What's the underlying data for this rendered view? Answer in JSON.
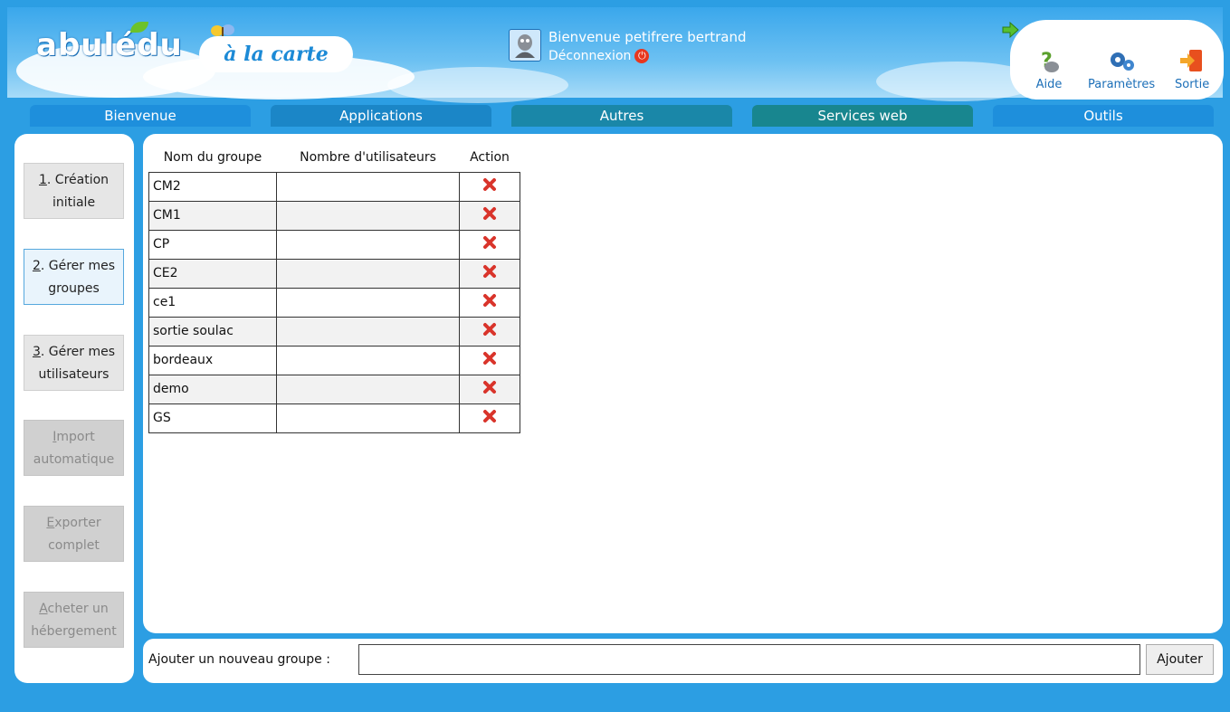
{
  "header": {
    "logo_text": "abulédu",
    "badge_text": "à la carte",
    "welcome_text": "Bienvenue petifrere bertrand",
    "logout_label": "Déconnexion",
    "tools": [
      {
        "label": "Aide",
        "icon": "help-icon"
      },
      {
        "label": "Paramètres",
        "icon": "gears-icon"
      },
      {
        "label": "Sortie",
        "icon": "exit-icon"
      }
    ]
  },
  "nav": {
    "tabs": [
      {
        "label": "Bienvenue",
        "color": "#1e8fdc"
      },
      {
        "label": "Applications",
        "color": "#1b86c7"
      },
      {
        "label": "Autres",
        "color": "#1a87a8"
      },
      {
        "label": "Services web",
        "color": "#18868f"
      },
      {
        "label": "Outils",
        "color": "#1e8fdc"
      }
    ]
  },
  "sidebar": {
    "items": [
      {
        "key": "1",
        "rest": ". Création",
        "line2": "initiale",
        "state": "normal"
      },
      {
        "key": "2",
        "rest": ". Gérer mes",
        "line2": "groupes",
        "state": "active"
      },
      {
        "key": "3",
        "rest": ". Gérer mes",
        "line2": "utilisateurs",
        "state": "normal"
      },
      {
        "key": "I",
        "rest": "mport",
        "line2": "automatique",
        "state": "disabled"
      },
      {
        "key": "E",
        "rest": "xporter",
        "line2": "complet",
        "state": "disabled"
      },
      {
        "key": "A",
        "rest": "cheter un",
        "line2": "hébergement",
        "state": "disabled"
      }
    ]
  },
  "table": {
    "headers": [
      "Nom du groupe",
      "Nombre d'utilisateurs",
      "Action"
    ],
    "rows": [
      {
        "name": "CM2",
        "count": ""
      },
      {
        "name": "CM1",
        "count": ""
      },
      {
        "name": "CP",
        "count": ""
      },
      {
        "name": "CE2",
        "count": ""
      },
      {
        "name": "ce1",
        "count": ""
      },
      {
        "name": "sortie soulac",
        "count": ""
      },
      {
        "name": "bordeaux",
        "count": ""
      },
      {
        "name": "demo",
        "count": ""
      },
      {
        "name": "GS",
        "count": ""
      }
    ],
    "action_icon": "delete-x-icon"
  },
  "add_group": {
    "label": "Ajouter un nouveau groupe :",
    "input_value": "",
    "button_label": "Ajouter"
  },
  "colors": {
    "background": "#2c9ee3",
    "delete_red": "#d9342b",
    "active_border": "#56a8de"
  }
}
